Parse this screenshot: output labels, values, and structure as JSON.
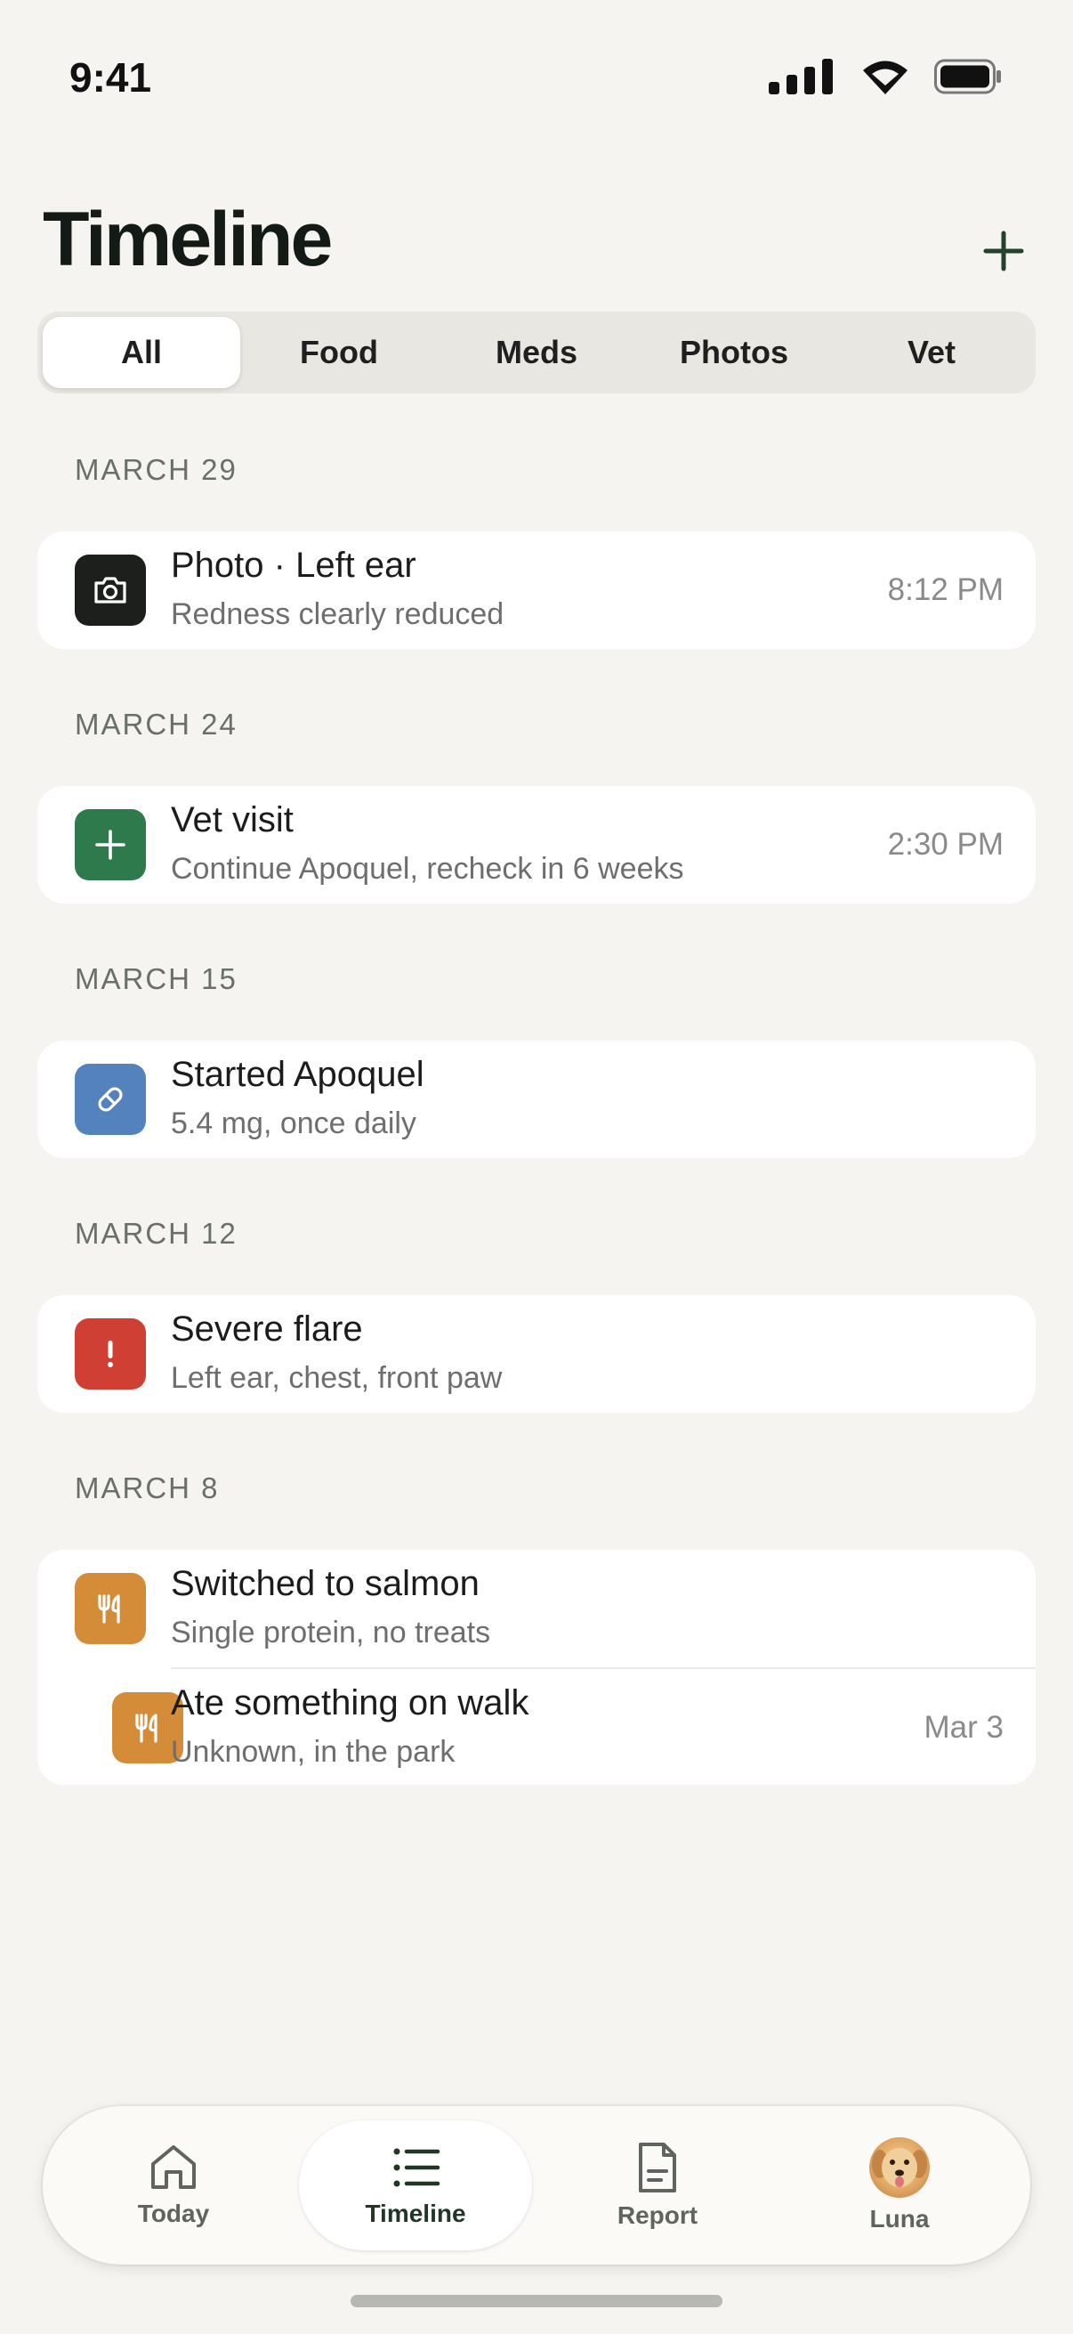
{
  "status_bar": {
    "time": "9:41"
  },
  "header": {
    "title": "Timeline"
  },
  "filters": [
    "All",
    "Food",
    "Meds",
    "Photos",
    "Vet"
  ],
  "active_filter": "All",
  "sections": [
    {
      "date": "MARCH 29",
      "entries": [
        {
          "title": "Photo · Left ear",
          "subtitle": "Redness clearly reduced",
          "time": "8:12 PM",
          "icon": "camera-icon",
          "color": "#1c1f1c"
        }
      ]
    },
    {
      "date": "MARCH 24",
      "entries": [
        {
          "title": "Vet visit",
          "subtitle": "Continue Apoquel, recheck in 6 weeks",
          "time": "2:30 PM",
          "icon": "plus-icon",
          "color": "#2f7a4d"
        }
      ]
    },
    {
      "date": "MARCH 15",
      "entries": [
        {
          "title": "Started Apoquel",
          "subtitle": "5.4 mg, once daily",
          "time": "",
          "icon": "pill-icon",
          "color": "#5482bd"
        }
      ]
    },
    {
      "date": "MARCH 12",
      "entries": [
        {
          "title": "Severe flare",
          "subtitle": "Left ear, chest, front paw",
          "time": "",
          "icon": "alert-icon",
          "color": "#cf3f34"
        }
      ]
    },
    {
      "date": "MARCH 8",
      "entries": [
        {
          "title": "Switched to salmon",
          "subtitle": "Single protein, no treats",
          "time": "",
          "icon": "fork-knife-icon",
          "color": "#d48c38"
        },
        {
          "title": "Ate something on walk",
          "subtitle": "Unknown, in the park",
          "time": "Mar 3",
          "icon": "fork-knife-icon",
          "color": "#d48c38"
        }
      ]
    }
  ],
  "tabbar": {
    "items": [
      {
        "label": "Today",
        "icon": "home-icon"
      },
      {
        "label": "Timeline",
        "icon": "list-icon"
      },
      {
        "label": "Report",
        "icon": "document-icon"
      },
      {
        "label": "Luna",
        "icon": "avatar"
      }
    ],
    "active": "Timeline"
  }
}
